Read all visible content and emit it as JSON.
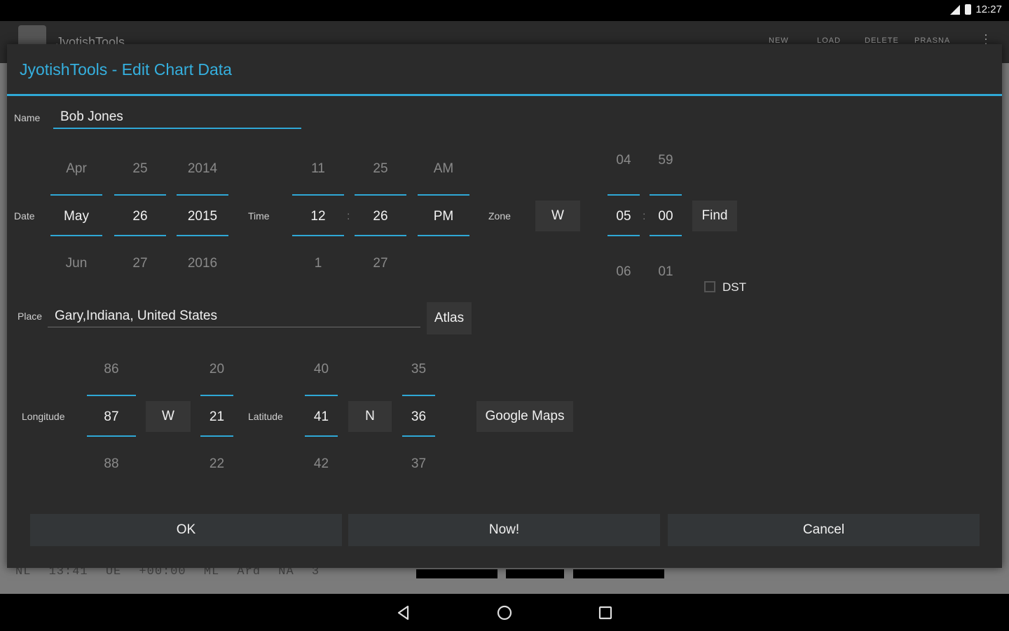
{
  "status": {
    "time": "12:27"
  },
  "app": {
    "title": "JyotishTools",
    "actions": [
      "NEW",
      "LOAD",
      "DELETE",
      "PRASNA"
    ],
    "bottom_text": "NL 13:41 UE +00:00 ML Ard NA 3"
  },
  "dialog": {
    "title": "JyotishTools - Edit Chart Data",
    "name": {
      "label": "Name",
      "value": "Bob Jones"
    },
    "date": {
      "label": "Date",
      "month": {
        "prev": "Apr",
        "value": "May",
        "next": "Jun"
      },
      "day": {
        "prev": "25",
        "value": "26",
        "next": "27"
      },
      "year": {
        "prev": "2014",
        "value": "2015",
        "next": "2016"
      }
    },
    "time": {
      "label": "Time",
      "hour": {
        "prev": "11",
        "value": "12",
        "next": "1"
      },
      "minute": {
        "prev": "25",
        "value": "26",
        "next": "27"
      },
      "ampm": {
        "prev": "AM",
        "value": "PM"
      },
      "separator": ":"
    },
    "zone": {
      "label": "Zone",
      "direction": "W",
      "hours": {
        "prev": "04",
        "value": "05",
        "next": "06"
      },
      "minutes": {
        "prev": "59",
        "value": "00",
        "next": "01"
      },
      "separator": ":",
      "find_label": "Find",
      "dst_label": "DST",
      "dst_checked": false
    },
    "place": {
      "label": "Place",
      "value": "Gary,Indiana, United States",
      "atlas_label": "Atlas"
    },
    "longitude": {
      "label": "Longitude",
      "degrees": {
        "prev": "86",
        "value": "87",
        "next": "88"
      },
      "direction": "W",
      "minutes": {
        "prev": "20",
        "value": "21",
        "next": "22"
      }
    },
    "latitude": {
      "label": "Latitude",
      "degrees": {
        "prev": "40",
        "value": "41",
        "next": "42"
      },
      "direction": "N",
      "minutes": {
        "prev": "35",
        "value": "36",
        "next": "37"
      }
    },
    "google_maps_label": "Google Maps",
    "buttons": {
      "ok": "OK",
      "now": "Now!",
      "cancel": "Cancel"
    }
  }
}
